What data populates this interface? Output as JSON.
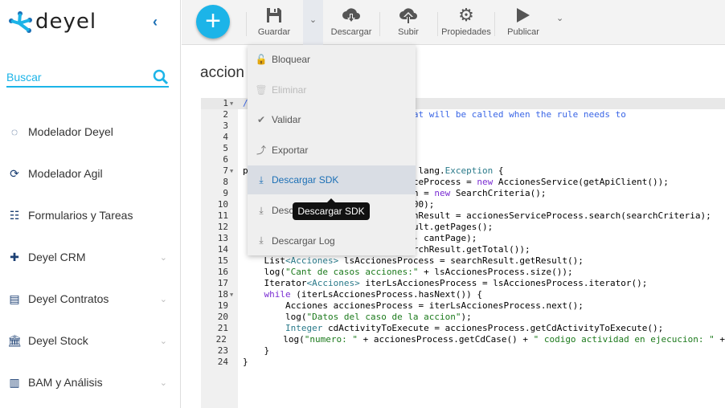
{
  "app": {
    "logo_text": "deyel",
    "brand_color": "#1cb4e8"
  },
  "sidebar": {
    "search_placeholder": "Buscar",
    "items": [
      {
        "label": "Modelador Deyel",
        "icon": "circle-arc-icon",
        "expandable": false
      },
      {
        "label": "Modelador Agil",
        "icon": "globe-arrow-icon",
        "expandable": false
      },
      {
        "label": "Formularios y Tareas",
        "icon": "form-icon",
        "expandable": false
      },
      {
        "label": "Deyel CRM",
        "icon": "puzzle-icon",
        "expandable": true
      },
      {
        "label": "Deyel Contratos",
        "icon": "document-icon",
        "expandable": true
      },
      {
        "label": "Deyel Stock",
        "icon": "bank-icon",
        "expandable": true
      },
      {
        "label": "BAM y Análisis",
        "icon": "bar-chart-icon",
        "expandable": true
      }
    ]
  },
  "toolbar": {
    "add": "+",
    "guardar": "Guardar",
    "descargar": "Descargar",
    "subir": "Subir",
    "propiedades": "Propiedades",
    "publicar": "Publicar"
  },
  "page": {
    "title": "accion"
  },
  "menu": {
    "items": [
      {
        "label": "Bloquear",
        "icon": "lock-icon",
        "state": "normal"
      },
      {
        "label": "Eliminar",
        "icon": "trash-icon",
        "state": "disabled"
      },
      {
        "label": "Validar",
        "icon": "check-icon",
        "state": "normal"
      },
      {
        "label": "Exportar",
        "icon": "export-icon",
        "state": "normal"
      },
      {
        "label": "Descargar SDK",
        "icon": "download-sdk-icon",
        "state": "highlighted"
      },
      {
        "label": "Desc",
        "icon": "download-icon",
        "state": "normal",
        "suffix": "a"
      },
      {
        "label": "Descargar Log",
        "icon": "download-log-icon",
        "state": "normal"
      }
    ]
  },
  "tooltip": "Descargar SDK",
  "code": {
    "lines": [
      {
        "n": "1",
        "fold": true,
        "html": "<span class='c'>/</span>"
      },
      {
        "n": "2",
        "html": "                        <span class='c'>ethod that will be called when the rule needs to</span>"
      },
      {
        "n": "3",
        "html": ""
      },
      {
        "n": "4",
        "html": ""
      },
      {
        "n": "5",
        "html": ""
      },
      {
        "n": "6",
        "html": ""
      },
      {
        "n": "7",
        "fold": true,
        "html": "p                                lang.<span class='t'>Exception</span> {"
      },
      {
        "n": "8",
        "html": "                                ceProcess = <span class='k'>new</span> AccionesService(getApiClient());"
      },
      {
        "n": "9",
        "html": "                                n = <span class='k'>new</span> SearchCriteria();"
      },
      {
        "n": "10",
        "html": "                                00);"
      },
      {
        "n": "11",
        "html": "                                nResult = accionesServiceProcess.search(searchCriteria);"
      },
      {
        "n": "12",
        "html": "                                ult.getPages();"
      },
      {
        "n": "13",
        "html": "                                - cantPage);"
      },
      {
        "n": "14",
        "html": "                                rchResult.getTotal());"
      },
      {
        "n": "15",
        "html": "    List<span class='t'>&lt;Acciones&gt;</span> lsAccionesProcess = searchResult.getResult();"
      },
      {
        "n": "16",
        "html": "    log(<span class='s'>\"Cant de casos acciones:\"</span> + lsAccionesProcess.size());"
      },
      {
        "n": "17",
        "html": "    Iterator<span class='t'>&lt;Acciones&gt;</span> iterLsAccionesProcess = lsAccionesProcess.iterator();"
      },
      {
        "n": "18",
        "fold": true,
        "html": "    <span class='k'>while</span> (iterLsAccionesProcess.hasNext()) {"
      },
      {
        "n": "19",
        "html": "        Acciones accionesProcess = iterLsAccionesProcess.next();"
      },
      {
        "n": "20",
        "html": "        log(<span class='s'>\"Datos del caso de la accion\"</span>);"
      },
      {
        "n": "21",
        "html": "        <span class='t'>Integer</span> cdActivityToExecute = accionesProcess.getCdActivityToExecute();"
      },
      {
        "n": "22",
        "html": "        log(<span class='s'>\"numero: \"</span> + accionesProcess.getCdCase() + <span class='s'>\" codigo actividad en ejecucion: \"</span> +"
      },
      {
        "n": "23",
        "html": "    }"
      },
      {
        "n": "24",
        "html": "}"
      }
    ]
  }
}
